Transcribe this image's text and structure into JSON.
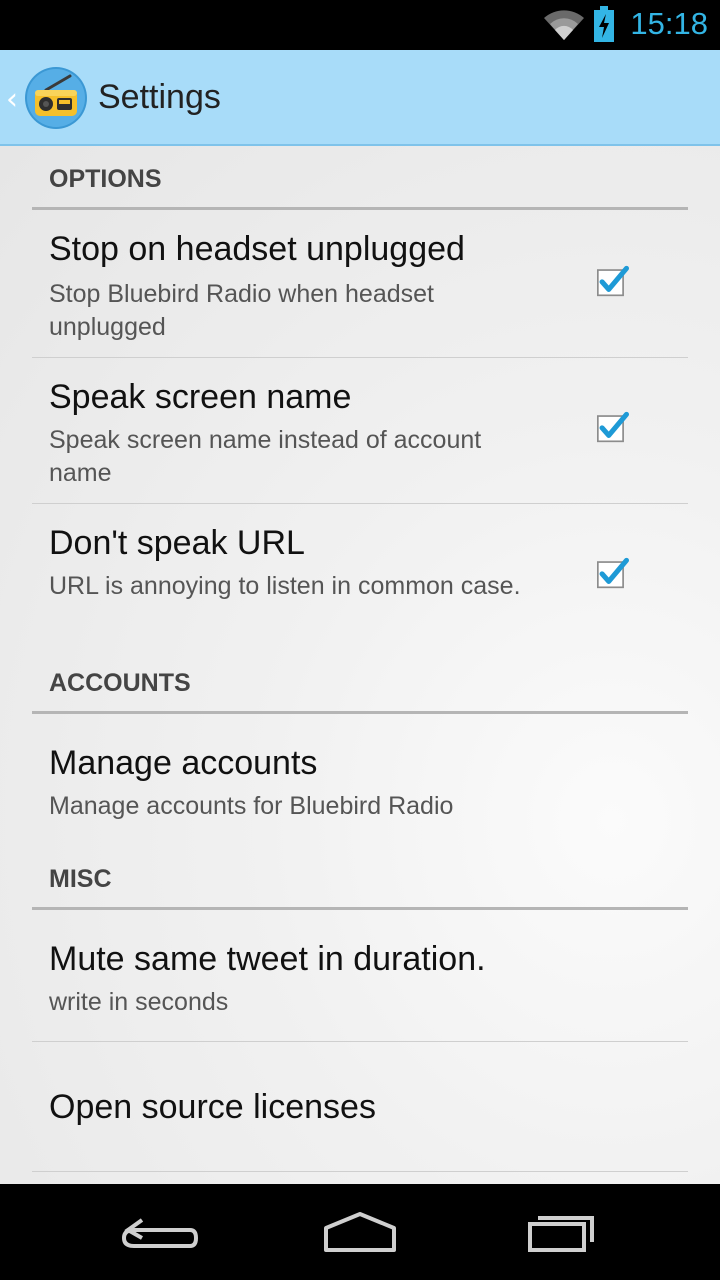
{
  "status_bar": {
    "time": "15:18",
    "icons": [
      "wifi-icon",
      "battery-charging-icon"
    ]
  },
  "action_bar": {
    "title": "Settings",
    "icon": "radio-app-icon",
    "up_indicator": "‹"
  },
  "sections": {
    "options": {
      "header": "OPTIONS",
      "items": [
        {
          "title": "Stop on headset unplugged",
          "summary": "Stop Bluebird Radio when headset unplugged",
          "checked": true
        },
        {
          "title": "Speak screen name",
          "summary": "Speak screen name instead of account name",
          "checked": true
        },
        {
          "title": "Don't speak URL",
          "summary": "URL is annoying to listen in common case.",
          "checked": true
        }
      ]
    },
    "accounts": {
      "header": "ACCOUNTS",
      "items": [
        {
          "title": "Manage accounts",
          "summary": "Manage accounts for Bluebird Radio"
        }
      ]
    },
    "misc": {
      "header": "MISC",
      "items": [
        {
          "title": "Mute same tweet in duration.",
          "summary": "write in seconds"
        },
        {
          "title": "Open source licenses"
        }
      ]
    }
  },
  "nav_bar": {
    "buttons": [
      "back-icon",
      "home-icon",
      "recents-icon"
    ]
  },
  "colors": {
    "action_bar": "#a8dcf9",
    "accent": "#33b5e5",
    "divider": "#b5b5b5"
  }
}
